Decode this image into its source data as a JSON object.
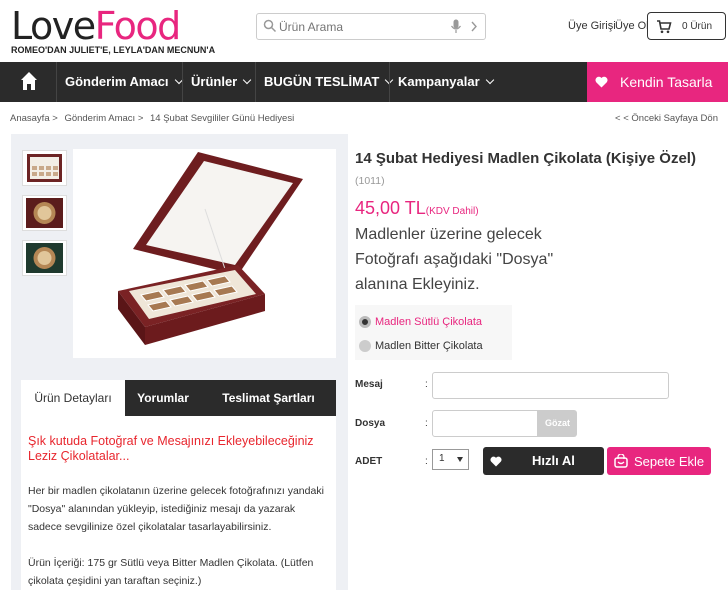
{
  "header": {
    "logo_love": "Love",
    "logo_food": "Food",
    "tagline": "ROMEO'DAN JULIET'E, LEYLA'DAN MECNUN'A",
    "search_placeholder": "Ürün Arama",
    "login": "Üye Girişi",
    "register": "Üye Ol",
    "cart_label": "0 Ürün"
  },
  "nav": {
    "items": [
      "Gönderim Amacı",
      "Ürünler",
      "BUGÜN TESLİMAT",
      "Kampanyalar"
    ],
    "design": "Kendin Tasarla"
  },
  "breadcrumb": {
    "items": [
      "Anasayfa >",
      "Gönderim Amacı >",
      "14 Şubat Sevgililer Günü Hediyesi"
    ],
    "back": "< < Önceki Sayfaya Dön"
  },
  "product": {
    "title": "14 Şubat Hediyesi Madlen Çikolata (Kişiye Özel)",
    "code": "(1011)",
    "price": "45,00 TL",
    "price_note": "(KDV Dahil)",
    "desc": [
      "Madlenler üzerine gelecek",
      "Fotoğrafı aşağıdaki \"Dosya\"",
      "alanına Ekleyiniz."
    ],
    "options": [
      "Madlen Sütlü Çikolata",
      "Madlen Bitter Çikolata"
    ],
    "selected_option": "Madlen Sütlü Çikolata"
  },
  "form": {
    "message_label": "Mesaj",
    "file_label": "Dosya",
    "qty_label": "ADET",
    "colon": ":",
    "browse": "Gözat",
    "qty_value": "1",
    "quick_buy": "Hızlı Al",
    "add_to_cart": "Sepete Ekle"
  },
  "tabs": {
    "items": [
      "Ürün Detayları",
      "Yorumlar",
      "Teslimat Şartları"
    ],
    "active": "Ürün Detayları"
  },
  "details": {
    "headline": "Şık kutuda Fotoğraf ve Mesajınızı Ekleyebileceğiniz Leziz Çikolatalar...",
    "paragraph1": "Her bir madlen çikolatanın üzerine gelecek fotoğrafınızı yandaki \"Dosya\" alanından yükleyip, istediğiniz mesajı da yazarak sadece sevgilinize özel çikolatalar tasarlayabilirsiniz.",
    "paragraph2": "Ürün İçeriği: 175 gr Sütlü veya Bitter Madlen Çikolata. (Lütfen çikolata çeşidini yan taraftan seçiniz.)"
  },
  "colors": {
    "brand_pink": "#e8267f",
    "nav_dark": "#2b2b2b",
    "headline_red": "#e8262e"
  },
  "icons": [
    "search-icon",
    "mic-icon",
    "arrow-right-icon",
    "cart-icon",
    "home-icon",
    "heart-icon",
    "basket-icon",
    "chevron-down-icon"
  ]
}
